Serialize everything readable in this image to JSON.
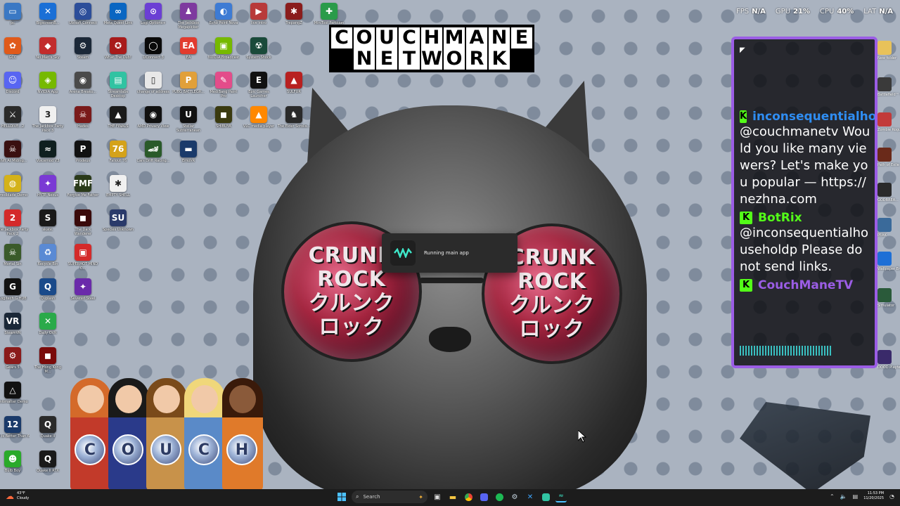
{
  "brand": {
    "line1": "COUCHMANE",
    "line2": "NETWORK"
  },
  "perf": [
    {
      "label": "FPS",
      "value": "N/A"
    },
    {
      "label": "GPU",
      "value": "21%"
    },
    {
      "label": "CPU",
      "value": "40%"
    },
    {
      "label": "LAT",
      "value": "N/A"
    }
  ],
  "wallpaper": {
    "lens_text": [
      "CRUNK",
      "ROCK",
      "クルンク",
      "ロック"
    ]
  },
  "desktop_icons": [
    {
      "label": "pc",
      "color": "#3a78c4",
      "glyph": "▭"
    },
    {
      "label": "BigscreenB...",
      "color": "#1a6fd6",
      "glyph": "✕"
    },
    {
      "label": "Ubisoft Connect",
      "color": "#2c4e9a",
      "glyph": "◎"
    },
    {
      "label": "Meta Quest Link",
      "color": "#0a66c2",
      "glyph": "∞"
    },
    {
      "label": "Logi Options+",
      "color": "#6b3fd4",
      "glyph": "⊙"
    },
    {
      "label": "The Jackbox Megapicker",
      "color": "#7e3a9f",
      "glyph": "♟"
    },
    {
      "label": "Echo Point Nova",
      "color": "#3d7bd4",
      "glyph": "◐"
    },
    {
      "label": "live intro",
      "color": "#b83a3a",
      "glyph": "▶"
    },
    {
      "label": "TrepangZ",
      "color": "#8a1c1c",
      "glyph": "✱"
    },
    {
      "label": "MiniTool Partition",
      "color": "#2a9b4a",
      "glyph": "✚"
    },
    {
      "label": "GCC",
      "color": "#e05a1a",
      "glyph": "✿"
    },
    {
      "label": "No Man's Sky",
      "color": "#c22d2d",
      "glyph": "◆"
    },
    {
      "label": "Steam",
      "color": "#1b2838",
      "glyph": "⚙"
    },
    {
      "label": "What The Dub!",
      "color": "#a81b1b",
      "glyph": "✪"
    },
    {
      "label": "LiConnect 3",
      "color": "#0a0a0a",
      "glyph": "◯"
    },
    {
      "label": "EA",
      "color": "#e23b2e",
      "glyph": "EA"
    },
    {
      "label": "NVIDIA Broadcast",
      "color": "#76b900",
      "glyph": "▣"
    },
    {
      "label": "System Shock",
      "color": "#1a4a3a",
      "glyph": "☢"
    },
    {
      "label": "Discord",
      "color": "#5865f2",
      "glyph": "☺"
    },
    {
      "label": "NVIDIA App",
      "color": "#76b900",
      "glyph": "◈"
    },
    {
      "label": "Arena Breako...",
      "color": "#4a4a4a",
      "glyph": "◉"
    },
    {
      "label": "Streamlabs Desktop",
      "color": "#31c3a2",
      "glyph": "▤"
    },
    {
      "label": "change of address",
      "color": "#e8e8e8",
      "glyph": "▯"
    },
    {
      "label": "PUBG BATTLEGR...",
      "color": "#e1a03a",
      "glyph": "P"
    },
    {
      "label": "MediBang Paint Pro",
      "color": "#e34c8a",
      "glyph": "✎"
    },
    {
      "label": "Epic Games Launcher",
      "color": "#111111",
      "glyph": "E"
    },
    {
      "label": "SULFUR",
      "color": "#b82020",
      "glyph": "▲"
    },
    {
      "label": "HELLDIVE...2",
      "color": "#2a2a2a",
      "glyph": "⚔"
    },
    {
      "label": "The Jackbox Party Pack 3",
      "color": "#f0f0f0",
      "glyph": "3"
    },
    {
      "label": "Hades",
      "color": "#7a1a1a",
      "glyph": "☠"
    },
    {
      "label": "THE FINALS",
      "color": "#1a1a1a",
      "glyph": "▲"
    },
    {
      "label": "AMD Privacy View",
      "color": "#111111",
      "glyph": "◉"
    },
    {
      "label": "Stellar Subterranean",
      "color": "#111111",
      "glyph": "U"
    },
    {
      "label": "SHIBUYA",
      "color": "#3a3a10",
      "glyph": "◼"
    },
    {
      "label": "VLC media player",
      "color": "#ff8800",
      "glyph": "▲"
    },
    {
      "label": "The Elder Scrolls...",
      "color": "#2a2a2a",
      "glyph": "♞"
    },
    {
      "label": "Shift At Midnig...",
      "color": "#3a1010",
      "glyph": "☠"
    },
    {
      "label": "Voicemod V3",
      "color": "#0f1f1f",
      "glyph": "≈"
    },
    {
      "label": "Prodeus",
      "color": "#111111",
      "glyph": "P"
    },
    {
      "label": "Fallout 76",
      "color": "#d4a21a",
      "glyph": "76"
    },
    {
      "label": "Cars Drift Racing...",
      "color": "#2a5a2a",
      "glyph": "🏎"
    },
    {
      "label": "EmuVR",
      "color": "#1a3a6a",
      "glyph": "▬"
    },
    {
      "label": "Dredblade Demo",
      "color": "#d4b21a",
      "glyph": "◍"
    },
    {
      "label": "HYTE Nexus",
      "color": "#7a3ad4",
      "glyph": "✦"
    },
    {
      "label": "Forgive Me Father",
      "color": "#2a3a1a",
      "glyph": "FMF"
    },
    {
      "label": "EMPTY SHELL",
      "color": "#f0f0f0",
      "glyph": "✱"
    },
    {
      "label": "The Jackbox Party Pack 2",
      "color": "#d42a2a",
      "glyph": "2"
    },
    {
      "label": "skate.",
      "color": "#1a1a1a",
      "glyph": "S"
    },
    {
      "label": "The Dark Wanderer",
      "color": "#3a0a0a",
      "glyph": "◼"
    },
    {
      "label": "Species Unknown",
      "color": "#2a3a6a",
      "glyph": "SU"
    },
    {
      "label": "Mortal Sin",
      "color": "#3a5a2a",
      "glyph": "☠"
    },
    {
      "label": "Recycle Bin",
      "color": "#5a8ad4",
      "glyph": "♻"
    },
    {
      "label": "SUPERHOT MIND C...",
      "color": "#d42a2a",
      "glyph": "▣"
    },
    {
      "label": "Logitech G HUB",
      "color": "#111111",
      "glyph": "G"
    },
    {
      "label": "Quplash",
      "color": "#1a4a8a",
      "glyph": "Q"
    },
    {
      "label": "Severed Steel",
      "color": "#6a2aaa",
      "glyph": "✦"
    },
    {
      "label": "SteamVR",
      "color": "#1b2838",
      "glyph": "VR"
    },
    {
      "label": "Daily OVR",
      "color": "#2aaa4a",
      "glyph": "✕"
    },
    {
      "label": "Gears 5",
      "color": "#8a1a1a",
      "glyph": "⚙"
    },
    {
      "label": "The Hong Kong M...",
      "color": "#7a0a0a",
      "glyph": "◼"
    },
    {
      "label": "Antimatter Demo",
      "color": "#111111",
      "glyph": "△"
    },
    {
      "label": "12 is Better Than 6",
      "color": "#1a3a6a",
      "glyph": "12"
    },
    {
      "label": "Quake II",
      "color": "#2a2a2a",
      "glyph": "Q"
    },
    {
      "label": "Bulb Boy",
      "color": "#2aaa2a",
      "glyph": "☻"
    },
    {
      "label": "Quake II RTX",
      "color": "#1a1a1a",
      "glyph": "Q"
    }
  ],
  "right_edge_labels": [
    "New folder",
    "Battlefield™ 6",
    "Zombie Rogue",
    "Path of Exile 2",
    "GODBREA...",
    "PEAK",
    "Wallpaper Engine",
    "Simulator",
    "DOOD Playtest"
  ],
  "toast": {
    "message": "Running main app"
  },
  "chat": {
    "messages": [
      {
        "username": "inconsequentialhou",
        "user_color": "#2f8df2",
        "text": "@couchmanetv Would you like many viewers? Let's make you popular — https://nezhna.com"
      },
      {
        "username": "BotRix",
        "user_color": "#53fc18",
        "text": "@inconsequentialhouseholdp Please do not send links."
      },
      {
        "username": "CouchManeTV",
        "user_color": "#9b5de5",
        "text": ""
      }
    ]
  },
  "characters": {
    "letters": [
      "C",
      "O",
      "U",
      "C",
      "H"
    ]
  },
  "taskbar": {
    "weather": {
      "temp": "43°F",
      "condition": "Cloudy"
    },
    "search_placeholder": "Search",
    "time": "11:53 PM",
    "date": "11/20/2025"
  }
}
